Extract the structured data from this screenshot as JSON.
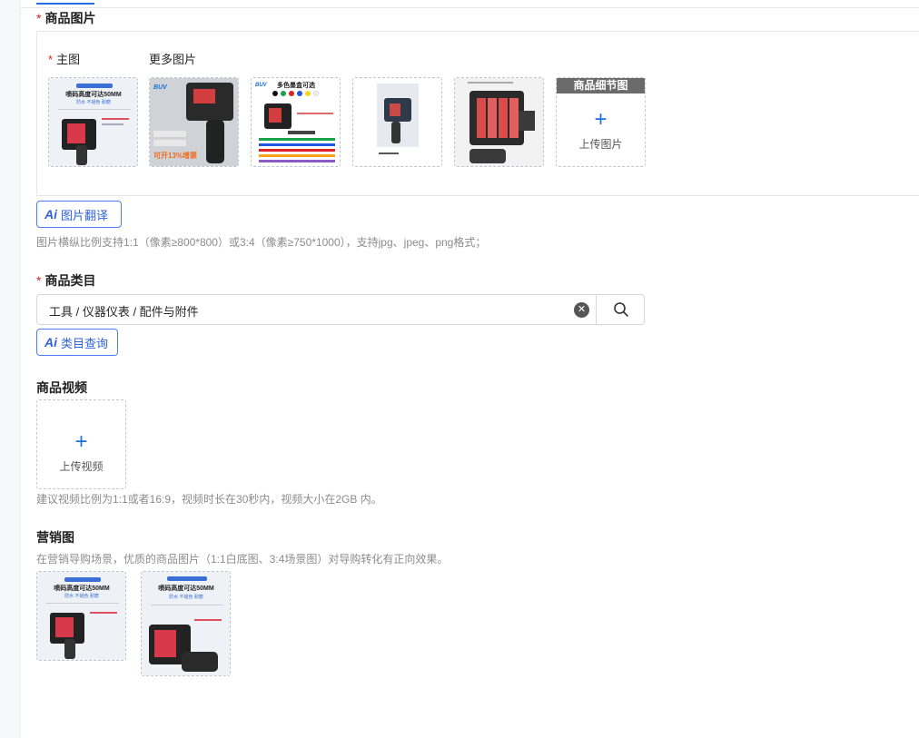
{
  "images_section": {
    "title": "商品图片",
    "main_label": "主图",
    "more_label": "更多图片",
    "detail_tag": "商品细节图",
    "upload_text": "上传图片",
    "thumbs": [
      {
        "headline": "喷码高度可达50MM",
        "sub": "防水 不褪色 耐磨"
      },
      {
        "headline": "BUV",
        "sub": "可开13%增票"
      },
      {
        "headline": "多色墨盒可选",
        "sub": "BUV"
      },
      {
        "headline": "",
        "sub": ""
      },
      {
        "headline": "",
        "sub": ""
      }
    ],
    "ai_button": "图片翻译",
    "ai_mark": "Ai",
    "hint": "图片横纵比例支持1:1（像素≥800*800）或3:4（像素≥750*1000），支持jpg、jpeg、png格式；"
  },
  "category_section": {
    "title": "商品类目",
    "value": "工具 / 仪器仪表 / 配件与附件",
    "ai_button": "类目查询",
    "ai_mark": "Ai"
  },
  "video_section": {
    "title": "商品视频",
    "upload_text": "上传视频",
    "hint": "建议视频比例为1:1或者16:9，视频时长在30秒内，视频大小在2GB 内。"
  },
  "marketing_section": {
    "title": "营销图",
    "hint": "在营销导购场景，优质的商品图片（1:1白底图、3:4场景图）对导购转化有正向效果。",
    "thumbs": [
      {
        "headline": "喷码高度可达50MM",
        "sub": "防水 不褪色 耐磨"
      },
      {
        "headline": "喷码高度可达50MM",
        "sub": "防水 不褪色 耐磨"
      }
    ]
  },
  "colors": {
    "accent": "#1f6fde",
    "required": "#e02020"
  }
}
